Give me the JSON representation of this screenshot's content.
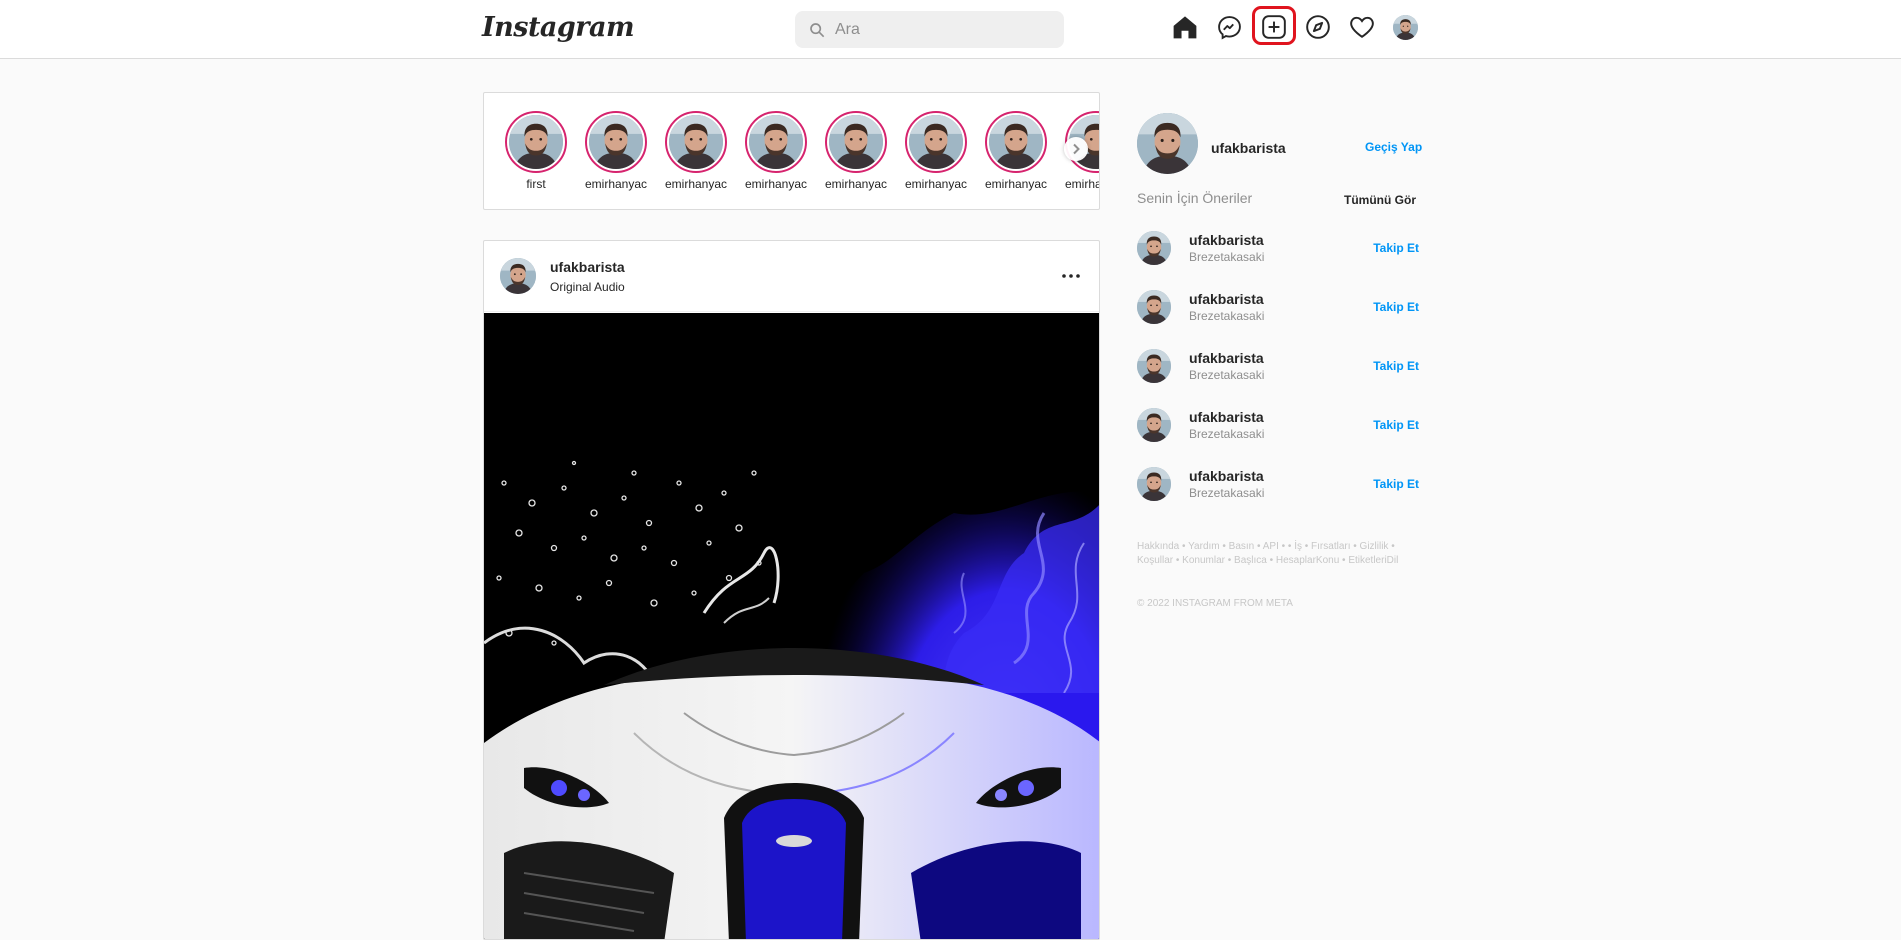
{
  "nav": {
    "logo": "Instagram",
    "search_placeholder": "Ara",
    "icons": [
      "home-icon",
      "messenger-icon",
      "new-post-icon",
      "explore-icon",
      "activity-heart-icon",
      "profile-avatar"
    ]
  },
  "stories": [
    {
      "username": "first"
    },
    {
      "username": "emirhanyac"
    },
    {
      "username": "emirhanyac"
    },
    {
      "username": "emirhanyac"
    },
    {
      "username": "emirhanyac"
    },
    {
      "username": "emirhanyac"
    },
    {
      "username": "emirhanyac"
    },
    {
      "username": "emirhanyac"
    }
  ],
  "post": {
    "username": "ufakbarista",
    "audio": "Original Audio"
  },
  "sidebar": {
    "username": "ufakbarista",
    "switch_label": "Geçiş Yap",
    "suggestions_title": "Senin İçin Öneriler",
    "see_all": "Tümünü Gör",
    "suggestions": [
      {
        "username": "ufakbarista",
        "subtitle": "Brezetakasaki",
        "action": "Takip Et"
      },
      {
        "username": "ufakbarista",
        "subtitle": "Brezetakasaki",
        "action": "Takip Et"
      },
      {
        "username": "ufakbarista",
        "subtitle": "Brezetakasaki",
        "action": "Takip Et"
      },
      {
        "username": "ufakbarista",
        "subtitle": "Brezetakasaki",
        "action": "Takip Et"
      },
      {
        "username": "ufakbarista",
        "subtitle": "Brezetakasaki",
        "action": "Takip Et"
      }
    ],
    "footer_links": "Hakkında • Yardım • Basın • API • • İş • Fırsatları • Gizlilik • Koşullar • Konumlar • Başlıca • HesaplarKonu • EtiketleriDil",
    "copyright": "© 2022 INSTAGRAM FROM META"
  },
  "colors": {
    "accent": "#0095f6",
    "story_ring": "#d6246e",
    "highlight": "#e0141e",
    "background": "#fafafa"
  }
}
